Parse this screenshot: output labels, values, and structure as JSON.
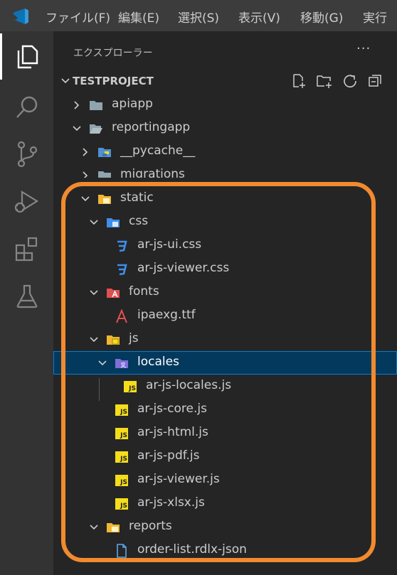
{
  "menubar": {
    "items": [
      "ファイル(F)",
      "編集(E)",
      "選択(S)",
      "表示(V)",
      "移動(G)",
      "実行"
    ]
  },
  "activity_bar": {
    "icons": [
      "explorer-icon",
      "search-icon",
      "source-control-icon",
      "run-debug-icon",
      "extensions-icon",
      "testing-icon"
    ]
  },
  "sidebar": {
    "title": "エクスプローラー",
    "more": "···",
    "project": "TESTPROJECT",
    "tree": [
      {
        "label": "apiapp",
        "kind": "folder",
        "expanded": false
      },
      {
        "label": "reportingapp",
        "kind": "folder",
        "expanded": true
      },
      {
        "label": "__pycache__",
        "kind": "python-folder",
        "expanded": false
      },
      {
        "label": "migrations",
        "kind": "folder",
        "expanded": false
      },
      {
        "label": "static",
        "kind": "static-folder",
        "expanded": true
      },
      {
        "label": "css",
        "kind": "css-folder",
        "expanded": true
      },
      {
        "label": "ar-js-ui.css",
        "kind": "css-file"
      },
      {
        "label": "ar-js-viewer.css",
        "kind": "css-file"
      },
      {
        "label": "fonts",
        "kind": "font-folder",
        "expanded": true
      },
      {
        "label": "ipaexg.ttf",
        "kind": "font-file"
      },
      {
        "label": "js",
        "kind": "js-folder",
        "expanded": true
      },
      {
        "label": "locales",
        "kind": "locale-folder",
        "expanded": true,
        "selected": true
      },
      {
        "label": "ar-js-locales.js",
        "kind": "js-file"
      },
      {
        "label": "ar-js-core.js",
        "kind": "js-file"
      },
      {
        "label": "ar-js-html.js",
        "kind": "js-file"
      },
      {
        "label": "ar-js-pdf.js",
        "kind": "js-file"
      },
      {
        "label": "ar-js-viewer.js",
        "kind": "js-file"
      },
      {
        "label": "ar-js-xlsx.js",
        "kind": "js-file"
      },
      {
        "label": "reports",
        "kind": "folder",
        "expanded": true
      },
      {
        "label": "order-list.rdlx-json",
        "kind": "json-file"
      }
    ]
  },
  "colors": {
    "highlight": "#f28a2e",
    "selection": "#04395e",
    "js_yellow": "#f5de19",
    "css_blue": "#3f8ee8",
    "font_red": "#e05050"
  }
}
